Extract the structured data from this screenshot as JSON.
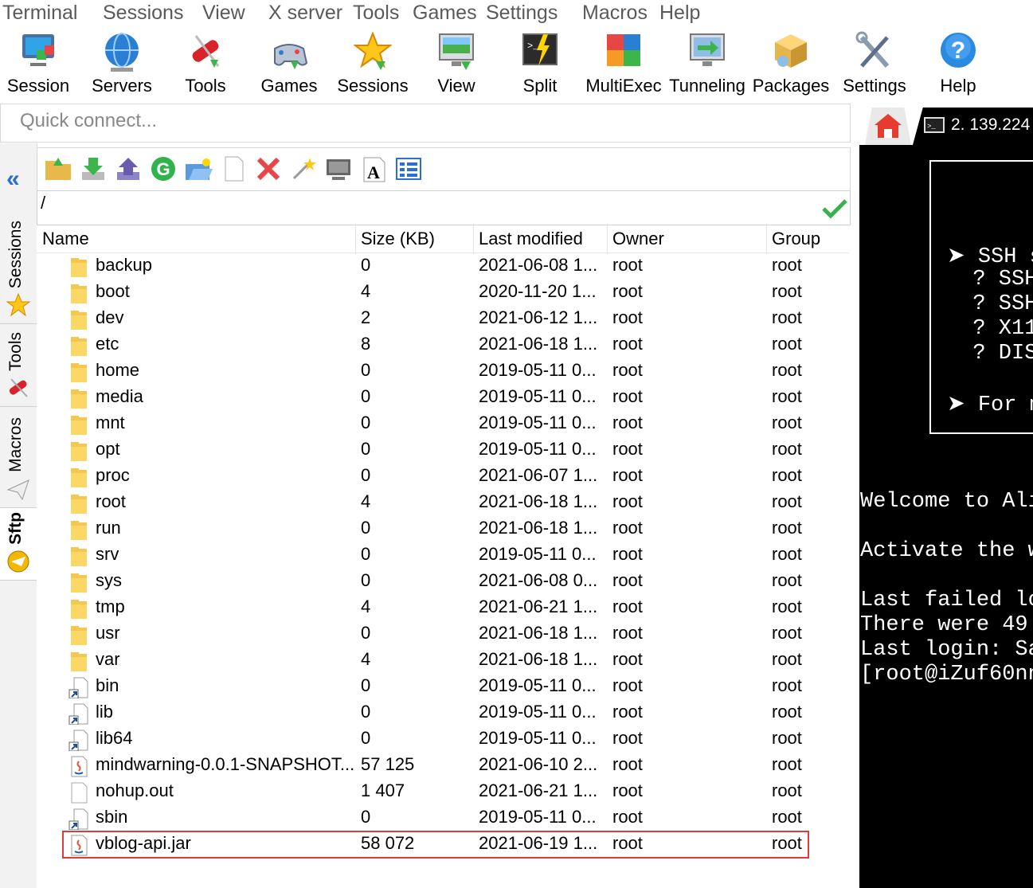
{
  "menu": [
    "Terminal",
    "Sessions",
    "View",
    "X server",
    "Tools",
    "Games",
    "Settings",
    "Macros",
    "Help"
  ],
  "toolbar": [
    {
      "label": "Session",
      "icon": "session-icon"
    },
    {
      "label": "Servers",
      "icon": "servers-globe-icon"
    },
    {
      "label": "Tools",
      "icon": "tools-knife-icon"
    },
    {
      "label": "Games",
      "icon": "gamepad-icon"
    },
    {
      "label": "Sessions",
      "icon": "star-icon"
    },
    {
      "label": "View",
      "icon": "monitor-icon"
    },
    {
      "label": "Split",
      "icon": "split-terminal-icon"
    },
    {
      "label": "MultiExec",
      "icon": "multiexec-grid-icon"
    },
    {
      "label": "Tunneling",
      "icon": "tunneling-monitor-icon"
    },
    {
      "label": "Packages",
      "icon": "packages-icon"
    },
    {
      "label": "Settings",
      "icon": "wrench-screwdriver-icon"
    },
    {
      "label": "Help",
      "icon": "question-icon"
    }
  ],
  "quick_connect": {
    "placeholder": "Quick connect..."
  },
  "side_tabs": {
    "sessions": "Sessions",
    "tools": "Tools",
    "macros": "Macros",
    "sftp": "Sftp"
  },
  "sftp": {
    "path": "/",
    "columns": {
      "name": "Name",
      "size": "Size (KB)",
      "modified": "Last modified",
      "owner": "Owner",
      "group": "Group"
    },
    "rows": [
      {
        "name": "backup",
        "size": "0",
        "modified": "2021-06-08 1...",
        "owner": "root",
        "group": "root",
        "type": "folder"
      },
      {
        "name": "boot",
        "size": "4",
        "modified": "2020-11-20 1...",
        "owner": "root",
        "group": "root",
        "type": "folder"
      },
      {
        "name": "dev",
        "size": "2",
        "modified": "2021-06-12 1...",
        "owner": "root",
        "group": "root",
        "type": "folder"
      },
      {
        "name": "etc",
        "size": "8",
        "modified": "2021-06-18 1...",
        "owner": "root",
        "group": "root",
        "type": "folder"
      },
      {
        "name": "home",
        "size": "0",
        "modified": "2019-05-11 0...",
        "owner": "root",
        "group": "root",
        "type": "folder"
      },
      {
        "name": "media",
        "size": "0",
        "modified": "2019-05-11 0...",
        "owner": "root",
        "group": "root",
        "type": "folder"
      },
      {
        "name": "mnt",
        "size": "0",
        "modified": "2019-05-11 0...",
        "owner": "root",
        "group": "root",
        "type": "folder"
      },
      {
        "name": "opt",
        "size": "0",
        "modified": "2019-05-11 0...",
        "owner": "root",
        "group": "root",
        "type": "folder"
      },
      {
        "name": "proc",
        "size": "0",
        "modified": "2021-06-07 1...",
        "owner": "root",
        "group": "root",
        "type": "folder"
      },
      {
        "name": "root",
        "size": "4",
        "modified": "2021-06-18 1...",
        "owner": "root",
        "group": "root",
        "type": "folder"
      },
      {
        "name": "run",
        "size": "0",
        "modified": "2021-06-18 1...",
        "owner": "root",
        "group": "root",
        "type": "folder"
      },
      {
        "name": "srv",
        "size": "0",
        "modified": "2019-05-11 0...",
        "owner": "root",
        "group": "root",
        "type": "folder"
      },
      {
        "name": "sys",
        "size": "0",
        "modified": "2021-06-08 0...",
        "owner": "root",
        "group": "root",
        "type": "folder"
      },
      {
        "name": "tmp",
        "size": "4",
        "modified": "2021-06-21 1...",
        "owner": "root",
        "group": "root",
        "type": "folder"
      },
      {
        "name": "usr",
        "size": "0",
        "modified": "2021-06-18 1...",
        "owner": "root",
        "group": "root",
        "type": "folder"
      },
      {
        "name": "var",
        "size": "4",
        "modified": "2021-06-18 1...",
        "owner": "root",
        "group": "root",
        "type": "folder"
      },
      {
        "name": "bin",
        "size": "0",
        "modified": "2019-05-11 0...",
        "owner": "root",
        "group": "root",
        "type": "link"
      },
      {
        "name": "lib",
        "size": "0",
        "modified": "2019-05-11 0...",
        "owner": "root",
        "group": "root",
        "type": "link"
      },
      {
        "name": "lib64",
        "size": "0",
        "modified": "2019-05-11 0...",
        "owner": "root",
        "group": "root",
        "type": "link"
      },
      {
        "name": "mindwarning-0.0.1-SNAPSHOT...",
        "size": "57 125",
        "modified": "2021-06-10 2...",
        "owner": "root",
        "group": "root",
        "type": "jar"
      },
      {
        "name": "nohup.out",
        "size": "1 407",
        "modified": "2021-06-21 1...",
        "owner": "root",
        "group": "root",
        "type": "file"
      },
      {
        "name": "sbin",
        "size": "0",
        "modified": "2019-05-11 0...",
        "owner": "root",
        "group": "root",
        "type": "link"
      },
      {
        "name": "vblog-api.jar",
        "size": "58 072",
        "modified": "2021-06-19 1...",
        "owner": "root",
        "group": "root",
        "type": "jar",
        "highlighted": true
      }
    ]
  },
  "terminal_tab": {
    "label": "2. 139.224"
  },
  "terminal": {
    "box_lines": [
      "➤ SSH s",
      "  ? SSH",
      "  ? SSH",
      "  ? X11",
      "  ? DIS",
      "",
      "➤ For m"
    ],
    "lines": [
      "Welcome to Ali",
      "",
      "Activate the w",
      "",
      "Last failed lo",
      "There were 49",
      "Last login: Sa",
      "[root@iZuf60nn"
    ]
  },
  "colors": {
    "highlight_border": "#e0393e",
    "terminal_bg": "#000000",
    "folder": "#f5c74e"
  }
}
